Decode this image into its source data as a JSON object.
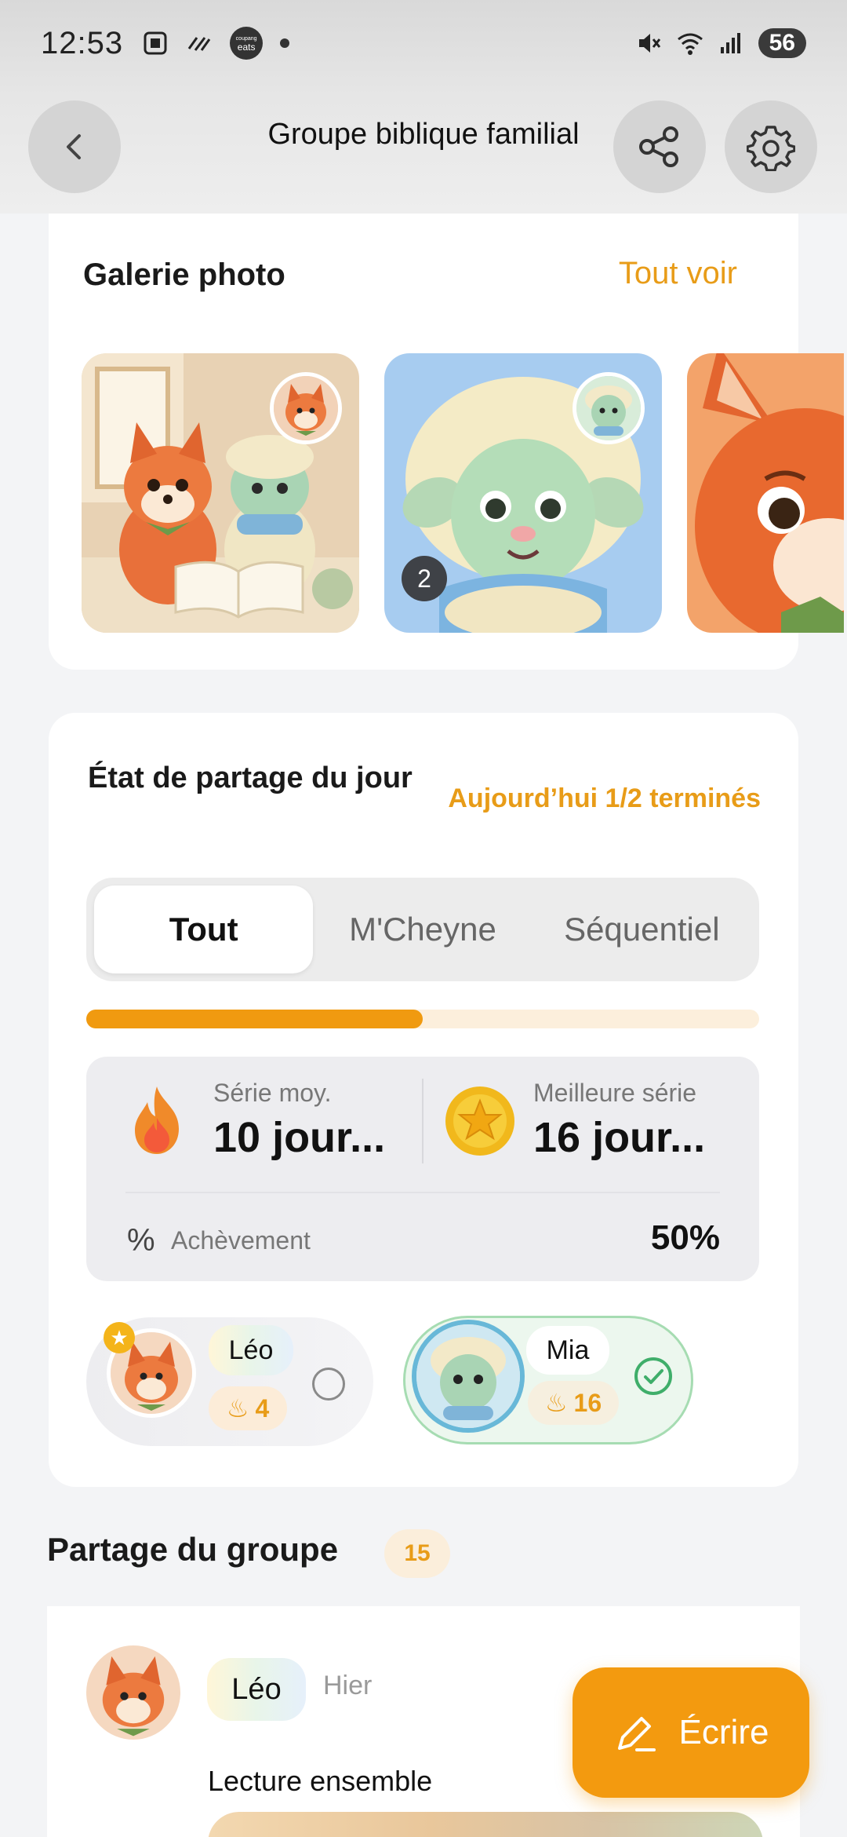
{
  "status_bar": {
    "time": "12:53",
    "coupang_line1": "coupang",
    "coupang_line2": "eats",
    "battery": "56"
  },
  "header": {
    "title": "Groupe biblique familial"
  },
  "gallery": {
    "title": "Galerie photo",
    "see_all": "Tout voir",
    "photos": [
      {
        "count": ""
      },
      {
        "count": "2"
      },
      {
        "count": ""
      }
    ]
  },
  "daily_status": {
    "title": "État de partage du jour",
    "today_summary": "Aujourd’hui 1/2 terminés",
    "tabs": [
      "Tout",
      "M'Cheyne",
      "Séquentiel"
    ],
    "active_tab": "Tout",
    "progress": 0.5,
    "avg_streak_label": "Série moy.",
    "avg_streak_value": "10 jour...",
    "best_streak_label": "Meilleure série",
    "best_streak_value": "16 jour...",
    "completion_label": "Achèvement",
    "completion_value": "50%",
    "members": [
      {
        "name": "Léo",
        "streak": "4",
        "done": false
      },
      {
        "name": "Mia",
        "streak": "16",
        "done": true
      }
    ]
  },
  "group_sharing": {
    "title": "Partage du groupe",
    "count": "15",
    "post": {
      "author": "Léo",
      "time": "Hier",
      "text": "Lecture ensemble"
    }
  },
  "fab": {
    "label": "Écrire"
  },
  "colors": {
    "accent": "#f09a10",
    "accent_text": "#e89c18",
    "done_green": "#3fae6a"
  }
}
